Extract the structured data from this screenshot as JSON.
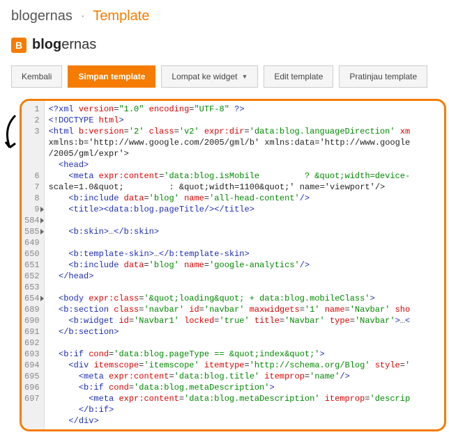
{
  "breadcrumb": {
    "main": "blogernas",
    "sep": "·",
    "current": "Template"
  },
  "brand": {
    "icon": "B",
    "name_bold": "blog",
    "name_light": "ernas"
  },
  "toolbar": {
    "back": "Kembali",
    "save": "Simpan template",
    "jump": "Lompat ke widget",
    "edit": "Edit template",
    "preview": "Pratinjau template"
  },
  "gutter": [
    "1",
    "2",
    "3",
    "",
    "",
    "",
    "6",
    "7",
    "8",
    "9",
    "584",
    "585",
    "649",
    "650",
    "651",
    "652",
    "653",
    "654",
    "689",
    "690",
    "691",
    "692",
    "693",
    "694",
    "695",
    "696",
    "697"
  ],
  "folds": [
    9,
    10,
    11,
    17
  ],
  "code": [
    "<?xml version=\"1.0\" encoding=\"UTF-8\" ?>",
    "<!DOCTYPE html>",
    "<html b:version='2' class='v2' expr:dir='data:blog.languageDirection' xm",
    "xmlns:b='http://www.google.com/2005/gml/b' xmlns:data='http://www.google",
    "/2005/gml/expr'>",
    "  <head>",
    "    <meta expr:content='data:blog.isMobile         ? &quot;width=device-",
    "scale=1.0&quot;         : &quot;width=1100&quot;' name='viewport'/>",
    "    <b:include data='blog' name='all-head-content'/>",
    "    <title><data:blog.pageTitle/></title>",
    "",
    "    <b:skin>…</b:skin>",
    "",
    "    <b:template-skin>…</b:template-skin>",
    "    <b:include data='blog' name='google-analytics'/>",
    "  </head>",
    "",
    "  <body expr:class='&quot;loading&quot; + data:blog.mobileClass'>",
    "  <b:section class='navbar' id='navbar' maxwidgets='1' name='Navbar' sho",
    "    <b:widget id='Navbar1' locked='true' title='Navbar' type='Navbar'>…<",
    "  </b:section>",
    "",
    "  <b:if cond='data:blog.pageType == &quot;index&quot;'>",
    "    <div itemscope='itemscope' itemtype='http://schema.org/Blog' style='",
    "      <meta expr:content='data:blog.title' itemprop='name'/>",
    "      <b:if cond='data:blog.metaDescription'>",
    "        <meta expr:content='data:blog.metaDescription' itemprop='descrip",
    "      </b:if>",
    "    </div>"
  ]
}
